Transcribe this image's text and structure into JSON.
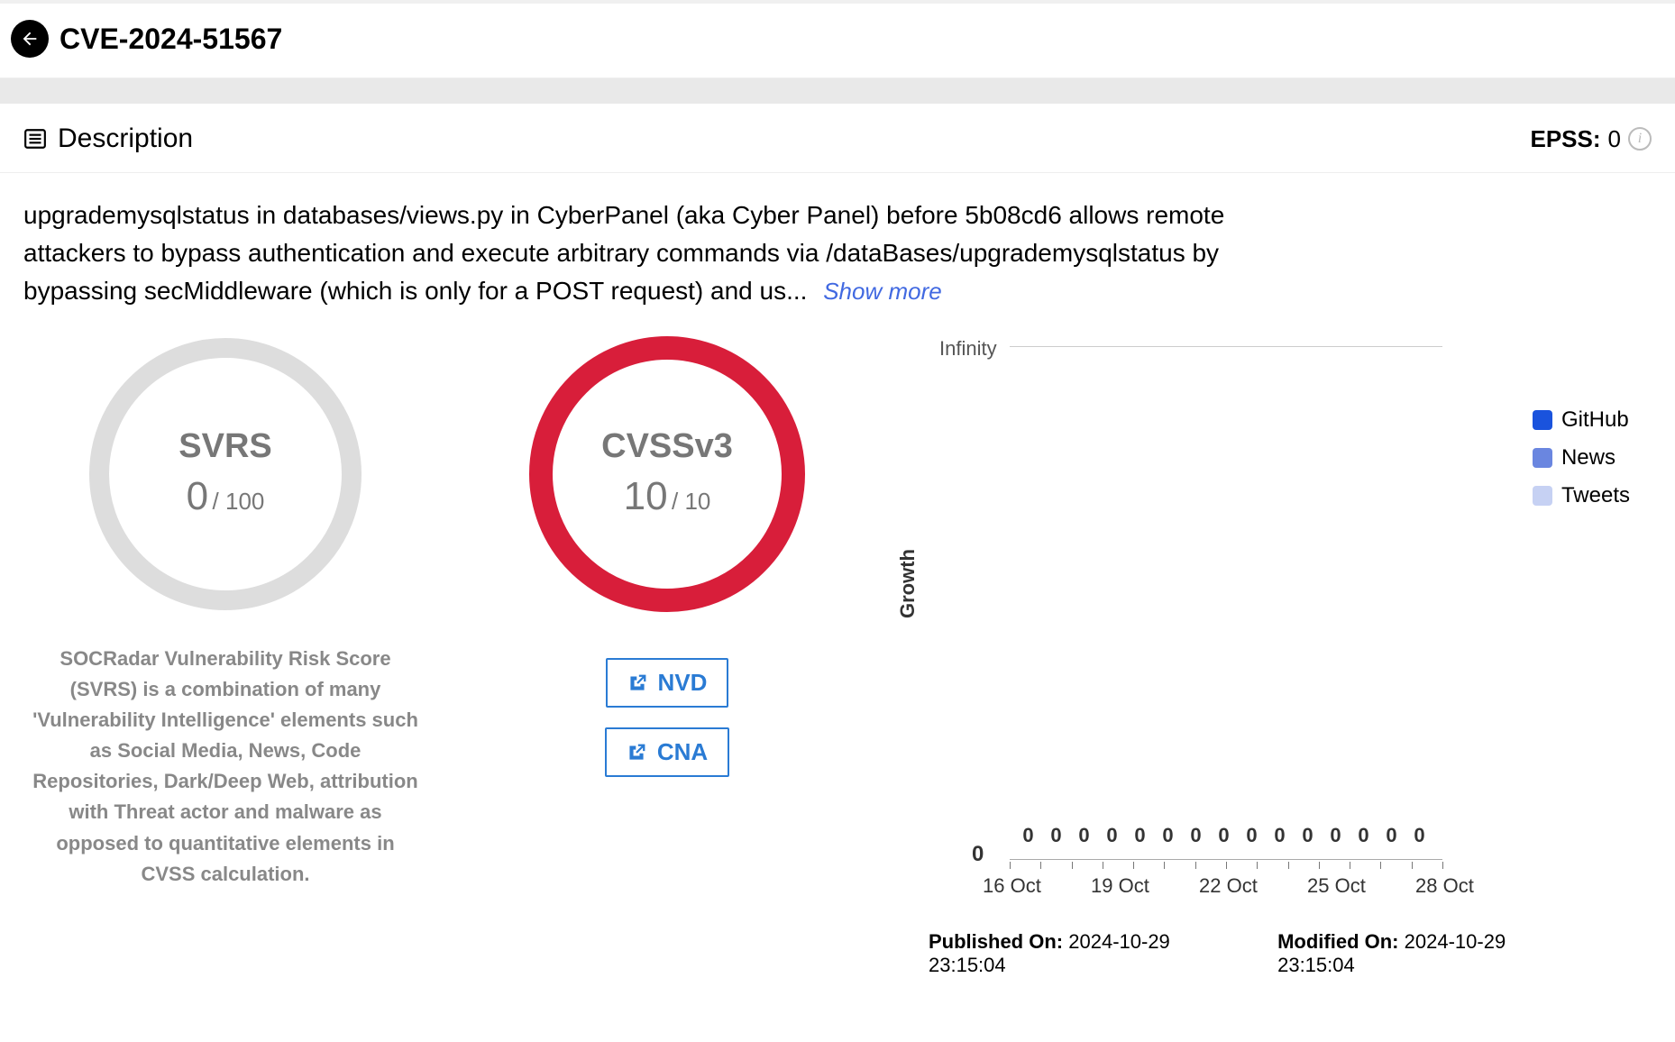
{
  "header": {
    "cve_id": "CVE-2024-51567"
  },
  "description": {
    "section_title": "Description",
    "epss_label": "EPSS:",
    "epss_value": "0",
    "text": "upgrademysqlstatus in databases/views.py in CyberPanel (aka Cyber Panel) before 5b08cd6 allows remote attackers to bypass authentication and execute arbitrary commands via /dataBases/upgrademysqlstatus by bypassing secMiddleware (which is only for a POST request) and us...",
    "show_more": "Show more"
  },
  "svrs": {
    "label": "SVRS",
    "value": "0",
    "max": "/ 100",
    "desc": "SOCRadar Vulnerability Risk Score (SVRS) is a combination of many 'Vulnerability Intelligence' elements such as Social Media, News, Code Repositories, Dark/Deep Web, attribution with Threat actor and malware as opposed to quantitative elements in CVSS calculation."
  },
  "cvss": {
    "label": "CVSSv3",
    "value": "10",
    "max": "/ 10",
    "links": {
      "nvd": "NVD",
      "cna": "CNA"
    }
  },
  "chart_data": {
    "type": "bar",
    "y_label": "Growth",
    "y_top": "Infinity",
    "y_zero": "0",
    "series": [
      {
        "name": "GitHub",
        "color": "#1a53dd"
      },
      {
        "name": "News",
        "color": "#6a86e0"
      },
      {
        "name": "Tweets",
        "color": "#c6d1f3"
      }
    ],
    "x_labels": [
      "16 Oct",
      "19 Oct",
      "22 Oct",
      "25 Oct",
      "28 Oct"
    ],
    "data_point_count": 15,
    "values": [
      0,
      0,
      0,
      0,
      0,
      0,
      0,
      0,
      0,
      0,
      0,
      0,
      0,
      0,
      0
    ]
  },
  "meta": {
    "published_label": "Published On:",
    "published_value": "2024-10-29 23:15:04",
    "modified_label": "Modified On:",
    "modified_value": "2024-10-29 23:15:04"
  }
}
